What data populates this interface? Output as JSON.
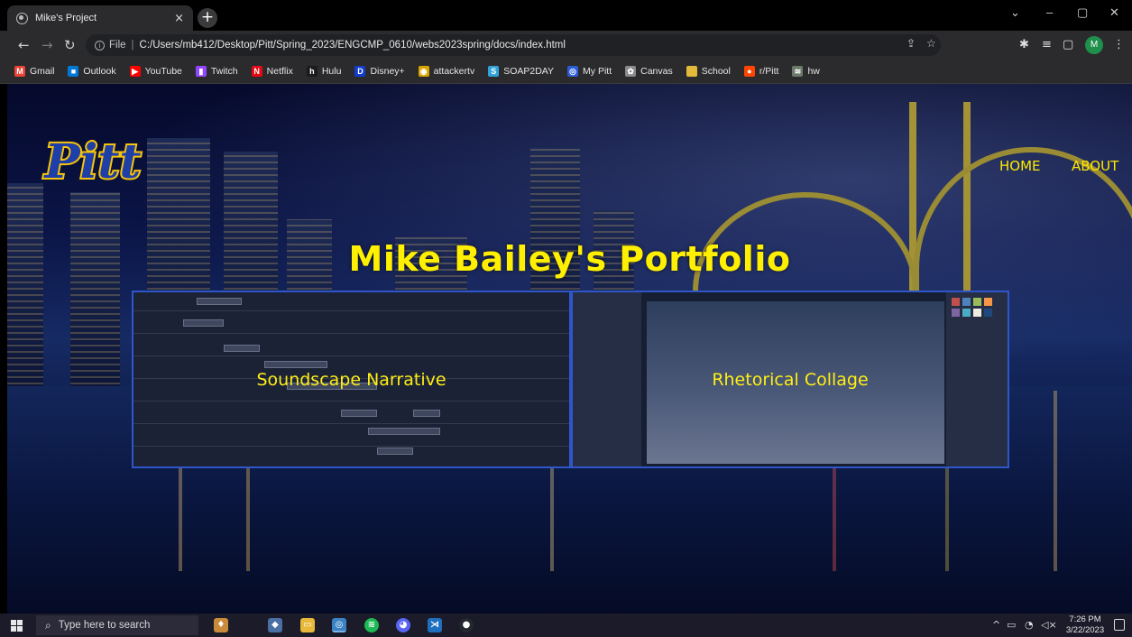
{
  "browser": {
    "tab_title": "Mike's Project",
    "tab_close": "×",
    "new_tab": "+",
    "window_controls": {
      "tabsearch": "⌄",
      "minimize": "–",
      "maximize": "▢",
      "close": "✕"
    },
    "address": {
      "scheme_label": "File",
      "url": "C:/Users/mb412/Desktop/Pitt/Spring_2023/ENGCMP_0610/webs2023spring/docs/index.html"
    },
    "profile_initial": "M",
    "bookmarks": [
      {
        "label": "Gmail",
        "icon": "gmail-icon",
        "color": "#ea4335",
        "glyph": "M"
      },
      {
        "label": "Outlook",
        "icon": "outlook-icon",
        "color": "#0078d4",
        "glyph": "■"
      },
      {
        "label": "YouTube",
        "icon": "youtube-icon",
        "color": "#ff0000",
        "glyph": "▶"
      },
      {
        "label": "Twitch",
        "icon": "twitch-icon",
        "color": "#9146ff",
        "glyph": "▮"
      },
      {
        "label": "Netflix",
        "icon": "netflix-icon",
        "color": "#e50914",
        "glyph": "N"
      },
      {
        "label": "Hulu",
        "icon": "hulu-icon",
        "color": "#1b1b1b",
        "glyph": "h"
      },
      {
        "label": "Disney+",
        "icon": "disney-icon",
        "color": "#113ccf",
        "glyph": "D"
      },
      {
        "label": "attackertv",
        "icon": "attackertv-icon",
        "color": "#d9a400",
        "glyph": "◉"
      },
      {
        "label": "SOAP2DAY",
        "icon": "soap2day-icon",
        "color": "#31a3d8",
        "glyph": "S"
      },
      {
        "label": "My Pitt",
        "icon": "mypitt-icon",
        "color": "#2b5cd6",
        "glyph": "◎"
      },
      {
        "label": "Canvas",
        "icon": "canvas-icon",
        "color": "#8a8a8a",
        "glyph": "✿"
      },
      {
        "label": "School",
        "icon": "folder-icon",
        "color": "#e2b93b",
        "glyph": ""
      },
      {
        "label": "r/Pitt",
        "icon": "reddit-icon",
        "color": "#ff4500",
        "glyph": "●"
      },
      {
        "label": "hw",
        "icon": "hw-icon",
        "color": "#6c7a6c",
        "glyph": "≋"
      }
    ]
  },
  "page": {
    "logo_text": "Pitt",
    "nav": {
      "home": "HOME",
      "about": "ABOUT"
    },
    "title": "Mike Bailey's Portfolio",
    "cards": [
      {
        "label": "Soundscape Narrative"
      },
      {
        "label": "Rhetorical Collage"
      }
    ],
    "colors": {
      "accent_yellow": "#ffef00",
      "card_border": "#2f56c8",
      "pitt_blue": "#1e3ea8",
      "pitt_gold": "#f6c40a"
    }
  },
  "taskbar": {
    "search_placeholder": "Type here to search",
    "clock_time": "7:26 PM",
    "clock_date": "3/22/2023"
  }
}
